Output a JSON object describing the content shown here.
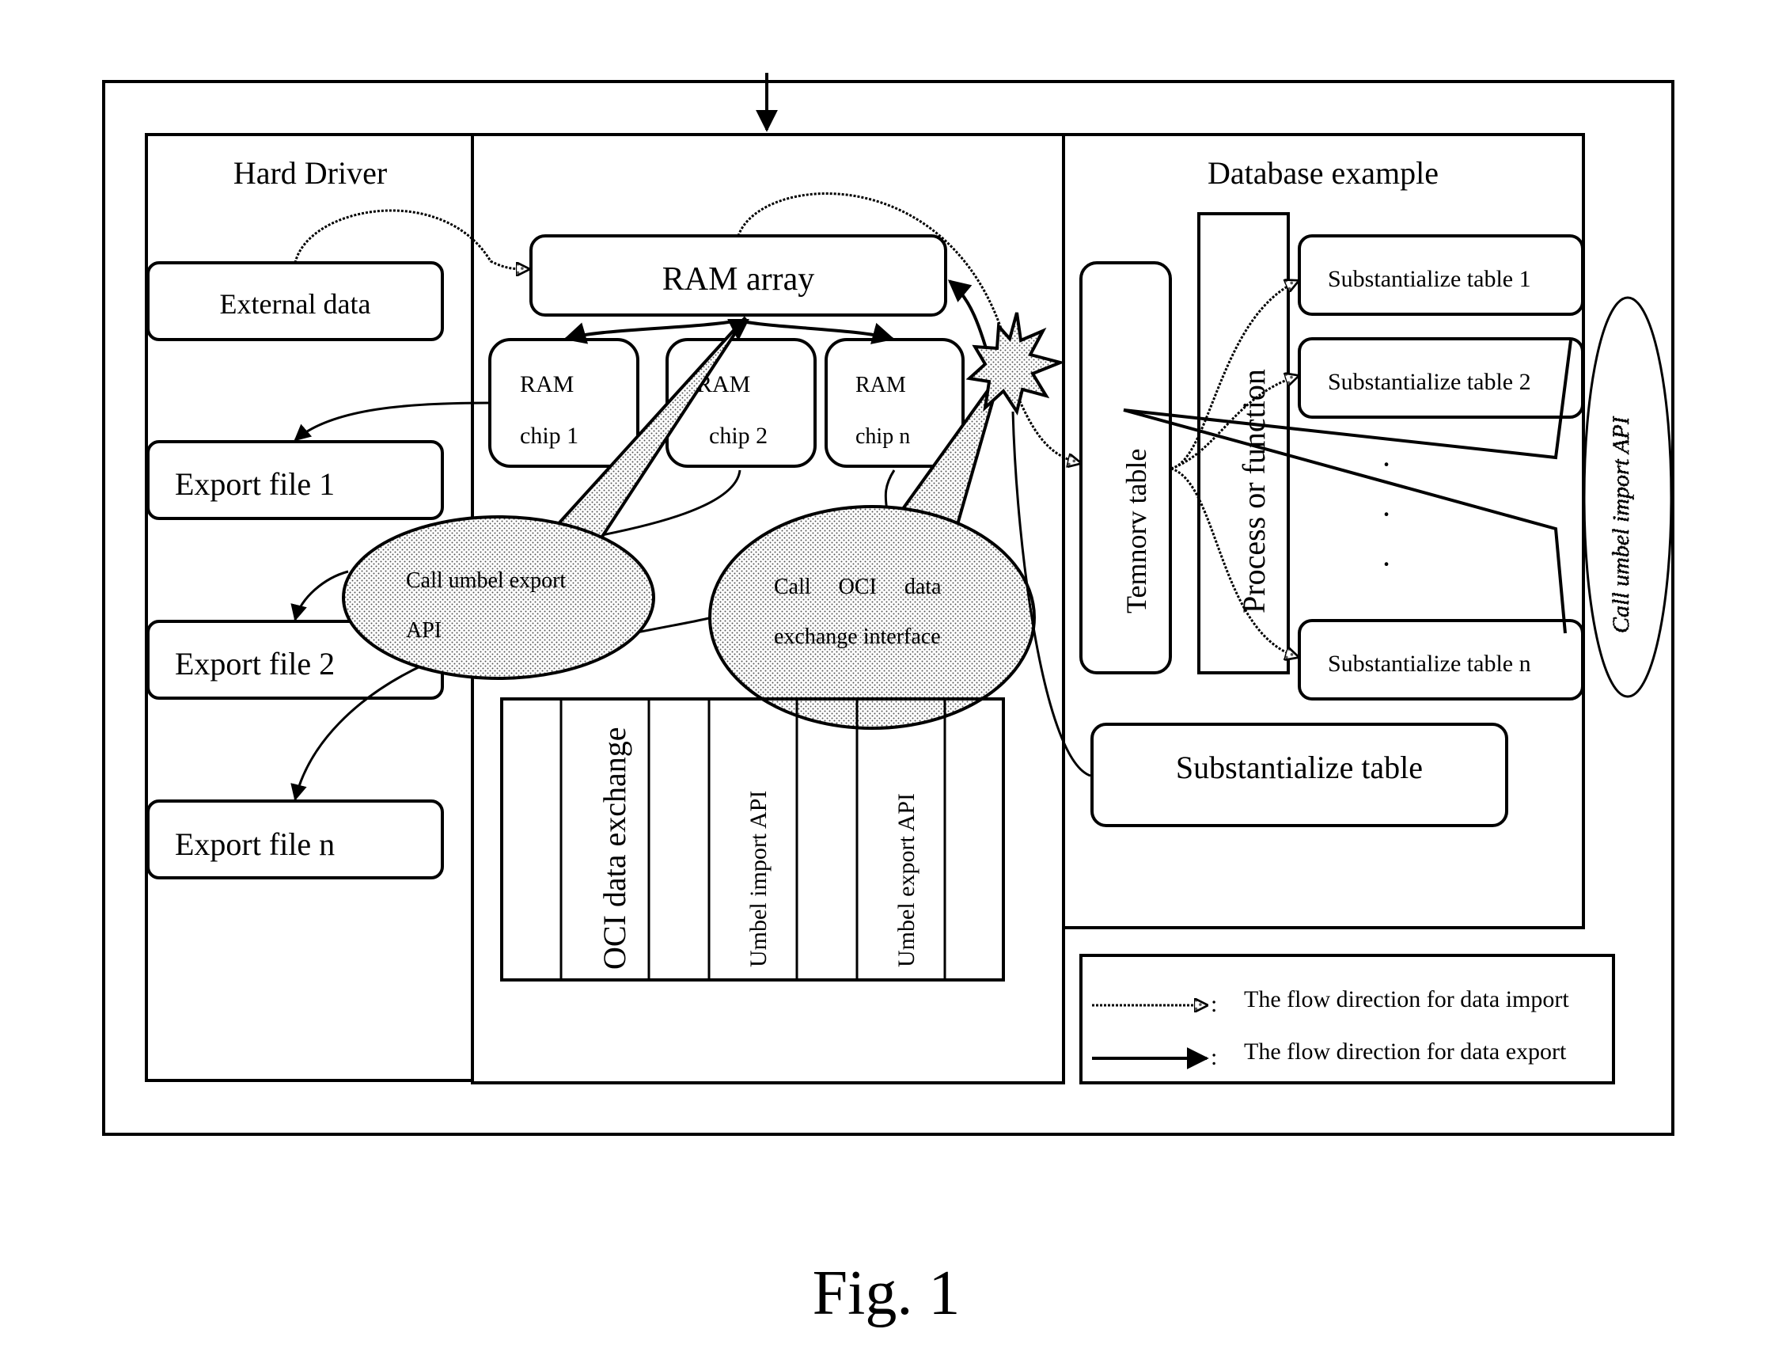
{
  "figure": {
    "caption": "Fig. 1",
    "hard_driver": {
      "title": "Hard Driver",
      "external_data": "External data",
      "export_files": [
        "Export file 1",
        "Export file 2",
        "Export file n"
      ]
    },
    "memory": {
      "ram_array": "RAM array",
      "ram_chips": [
        {
          "line1": "RAM",
          "line2": "chip 1"
        },
        {
          "line1": "RAM",
          "line2": "chip 2"
        },
        {
          "line1": "RAM",
          "line2": "chip n"
        }
      ],
      "api_columns": [
        "OCI data exchange",
        "Umbel import API",
        "Umbel export API"
      ],
      "callout_export": {
        "line1": "Call umbel export",
        "line2": "API"
      },
      "callout_oci": {
        "line1": "Call     OCI     data",
        "line2": "exchange interface"
      }
    },
    "database": {
      "title": "Database example",
      "temp_table": "Temnorv table",
      "process": "Process or function",
      "tables": [
        "Substantialize table 1",
        "Substantialize table 2",
        "Substantialize table n"
      ],
      "ellipsis": [
        "·",
        "·",
        "·"
      ],
      "substantialize_table": "Substantialize table",
      "callout_import": "Call umbel import API"
    },
    "legend": {
      "import": "The flow direction for data import",
      "export": "The flow direction for data export",
      "separator": ":"
    }
  }
}
